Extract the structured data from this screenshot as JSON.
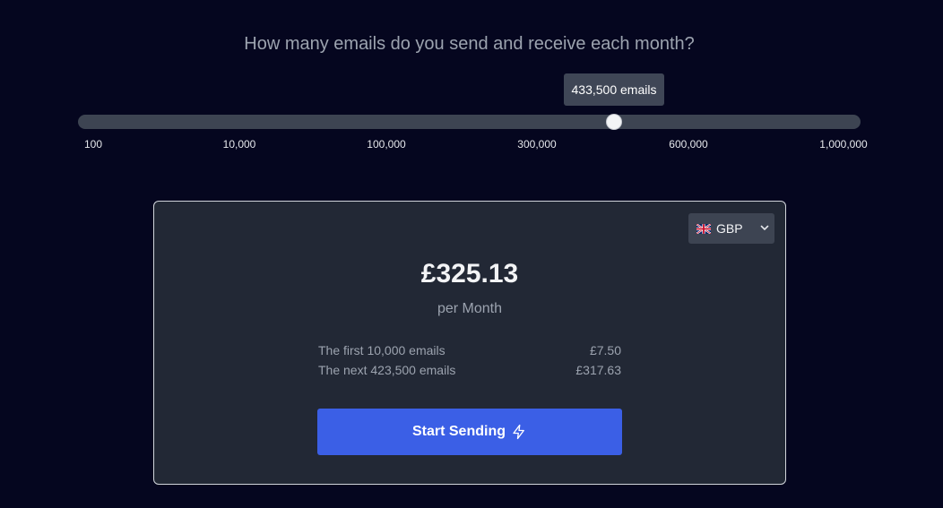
{
  "question": "How many emails do you send and receive each month?",
  "slider": {
    "tooltip": "433,500 emails",
    "value": 433500,
    "ticks": [
      "100",
      "10,000",
      "100,000",
      "300,000",
      "600,000",
      "1,000,000"
    ]
  },
  "card": {
    "currency": {
      "flag_icon": "uk-flag-icon",
      "code": "GBP"
    },
    "price": "£325.13",
    "period": "per Month",
    "breakdown": [
      {
        "label": "The first 10,000 emails",
        "amount": "£7.50"
      },
      {
        "label": "The next 423,500 emails",
        "amount": "£317.63"
      }
    ],
    "cta": {
      "label": "Start Sending",
      "icon": "lightning-icon"
    }
  },
  "colors": {
    "background": "#05061f",
    "card": "#222835",
    "accent": "#3b5fe6"
  }
}
